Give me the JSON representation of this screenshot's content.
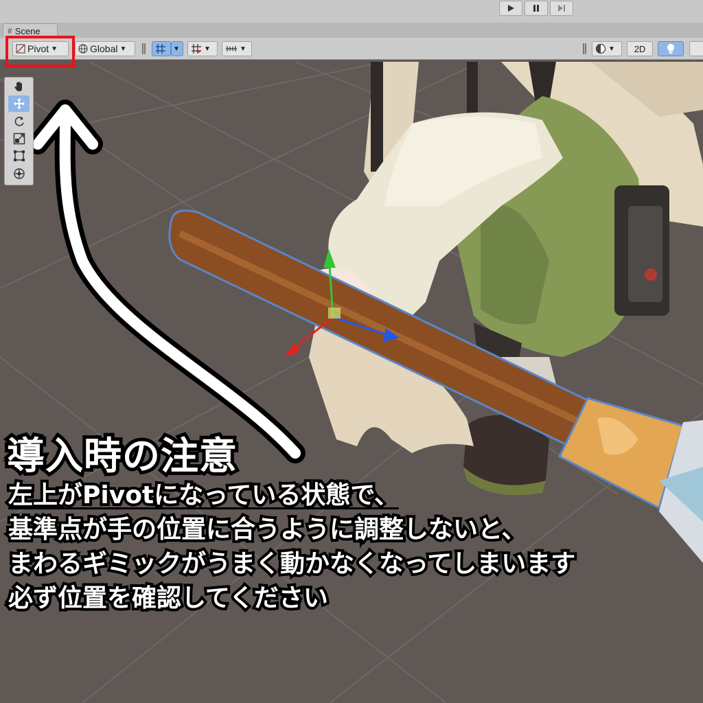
{
  "colors": {
    "viewport_bg": "#5f5855",
    "highlight_box": "#e8141c",
    "active_tool": "#8fb6e6",
    "broom_handle": "#8a4e22",
    "broom_band": "#e3a653",
    "axis_x": "#e3241c",
    "axis_y": "#33c43a",
    "axis_z": "#2357e8"
  },
  "scene_tab": {
    "label": "Scene",
    "icon": "grid-hash-icon"
  },
  "playback": {
    "buttons": [
      "play-icon",
      "pause-icon",
      "step-icon"
    ]
  },
  "toolbar": {
    "pivot_label": "Pivot",
    "global_label": "Global",
    "mode_2d_label": "2D",
    "icons": [
      "pivot-icon",
      "globe-icon",
      "grid-snap-icon",
      "increment-snap-icon",
      "ruler-icon",
      "shading-mode-icon",
      "lighting-icon"
    ]
  },
  "tools": [
    "hand-tool-icon",
    "move-tool-icon",
    "rotate-tool-icon",
    "scale-tool-icon",
    "rect-tool-icon",
    "transform-tool-icon"
  ],
  "annotation": {
    "heading": "導入時の注意",
    "line1": "左上がPivotになっている状態で、",
    "line2": "基準点が手の位置に合うように調整しないと、",
    "line3": "まわるギミックがうまく動かなくなってしまいます",
    "line4": "必ず位置を確認してください"
  }
}
